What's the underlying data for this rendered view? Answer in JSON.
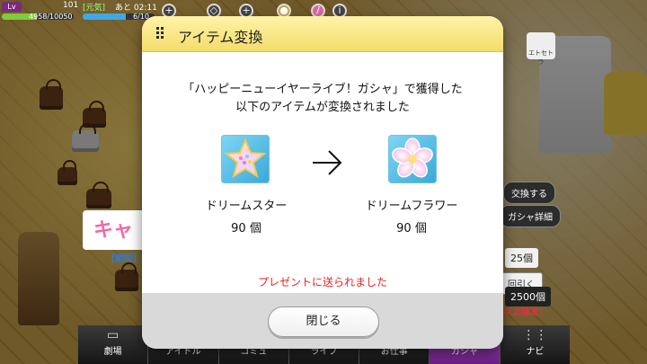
{
  "hud": {
    "lv_label": "Lv",
    "level": "101",
    "genki_label": "[元気]",
    "time_label": "あと 02:11",
    "stamina_text": "4958/10050",
    "stamina_fill": 0.49,
    "second_text": "6/10",
    "second_fill": 0.6
  },
  "background": {
    "elsetra_label": "エトセトラ",
    "banner_text": "キャ",
    "banner_period": "【期間】",
    "exchange_button": "交換する",
    "gacha_detail_button": "ガシャ詳細",
    "price_count": "25個",
    "draw_label": "回引く",
    "price_2500": "2500個",
    "confirm_label": "以上確定！"
  },
  "nav": {
    "items": [
      {
        "label": "劇場",
        "icon": "theater-icon"
      },
      {
        "label": "アイドル",
        "icon": "idol-icon"
      },
      {
        "label": "コミュ",
        "icon": "commu-icon"
      },
      {
        "label": "ライブ",
        "icon": "live-icon"
      },
      {
        "label": "お仕事",
        "icon": "work-icon"
      },
      {
        "label": "ガシャ",
        "icon": "gacha-icon"
      },
      {
        "label": "ナビ",
        "icon": "navi-icon"
      }
    ],
    "active_index": 5
  },
  "dialog": {
    "title": "アイテム変換",
    "message_line1": "「ハッピーニューイヤーライブ！ガシャ」で獲得した",
    "message_line2": "以下のアイテムが変換されました",
    "from_item": {
      "name": "ドリームスター",
      "quantity": "90 個",
      "icon": "dream-star-icon"
    },
    "to_item": {
      "name": "ドリームフラワー",
      "quantity": "90 個",
      "icon": "dream-flower-icon"
    },
    "arrow_icon": "right-arrow-icon",
    "notice": "プレゼントに送られました",
    "close_label": "閉じる"
  },
  "colors": {
    "header_yellow": "#f3dd6a",
    "notice_red": "#e52424",
    "nav_active": "#b94fd1"
  }
}
